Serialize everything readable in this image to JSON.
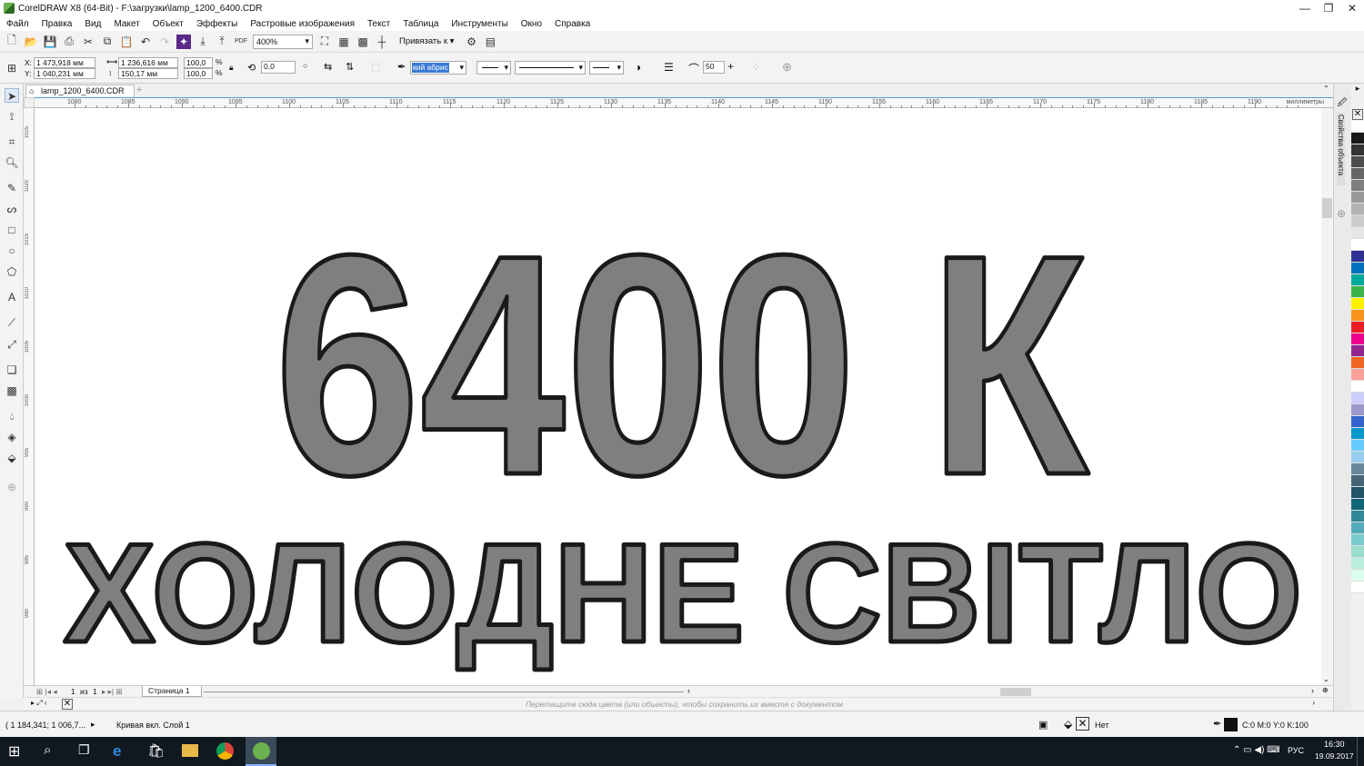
{
  "window": {
    "title": "CorelDRAW X8 (64-Bit) - F:\\загрузки\\lamp_1200_6400.CDR"
  },
  "menu": [
    "Файл",
    "Правка",
    "Вид",
    "Макет",
    "Объект",
    "Эффекты",
    "Растровые изображения",
    "Текст",
    "Таблица",
    "Инструменты",
    "Окно",
    "Справка"
  ],
  "toolbar1": {
    "zoom": "400%",
    "snap_label": "Привязать к",
    "pdf_label": "PDF"
  },
  "propbar": {
    "x_label": "X:",
    "x": "1 473,918 мм",
    "y_label": "Y:",
    "y": "1 040,231 мм",
    "w": "1 236,616 мм",
    "h": "150,17 мм",
    "scale_w": "100,0",
    "scale_h": "100,0",
    "pct": "%",
    "angle": "0,0",
    "outline": "кий абрис",
    "smooth": "50"
  },
  "document": {
    "tab": "lamp_1200_6400.CDR"
  },
  "ruler": {
    "ticks": [
      "1080",
      "1085",
      "1090",
      "1095",
      "1100",
      "1105",
      "1110",
      "1115",
      "1120",
      "1125",
      "1130",
      "1135",
      "1140",
      "1145",
      "1150",
      "1155",
      "1160",
      "1165",
      "1170",
      "1175",
      "1180",
      "1185",
      "1190"
    ],
    "unit": "миллиметры",
    "vticks": [
      "1025",
      "1020",
      "1015",
      "1010",
      "1005",
      "1000",
      "995",
      "990",
      "985",
      "980"
    ]
  },
  "canvas": {
    "line1": "6400 К",
    "line2": "ХОЛОДНЕ СВІТЛО",
    "fill_color": "#7f7f7f",
    "stroke_color": "#1a1a1a"
  },
  "pagenav": {
    "current": "1",
    "of": "из",
    "total": "1",
    "page_tab": "Страница 1"
  },
  "swatch_hint": "Перетащите сюда цвета (или объекты), чтобы сохранить их вместе с документом",
  "side_panel": "Свойства объекта",
  "status": {
    "coords": "( 1 184,341; 1 006,7...",
    "object": "Кривая вкл. Слой 1",
    "fill_none": "Нет",
    "outline_color": "C:0 M:0 Y:0 K:100"
  },
  "palette": [
    "#ffffff",
    "#1a1a1a",
    "#333333",
    "#4d4d4d",
    "#666666",
    "#7f7f7f",
    "#999999",
    "#b3b3b3",
    "#cccccc",
    "#e6e6e6",
    "#ffffff",
    "#2e3192",
    "#0071bc",
    "#00a99d",
    "#39b54a",
    "#fff200",
    "#f7941d",
    "#ed1c24",
    "#ec008c",
    "#92278f",
    "#f26522",
    "#f9a19a",
    "#ffffff",
    "#ccccff",
    "#9999cc",
    "#3366cc",
    "#0099cc",
    "#66ccff",
    "#99ccee",
    "#668899",
    "#446677",
    "#225566",
    "#116677",
    "#338899",
    "#55aabb",
    "#77cccc",
    "#99ddcc",
    "#bbeedd",
    "#ddffee",
    "#ffffff"
  ],
  "taskbar": {
    "time": "16:30",
    "date": "19.09.2017",
    "lang": "РУС"
  }
}
